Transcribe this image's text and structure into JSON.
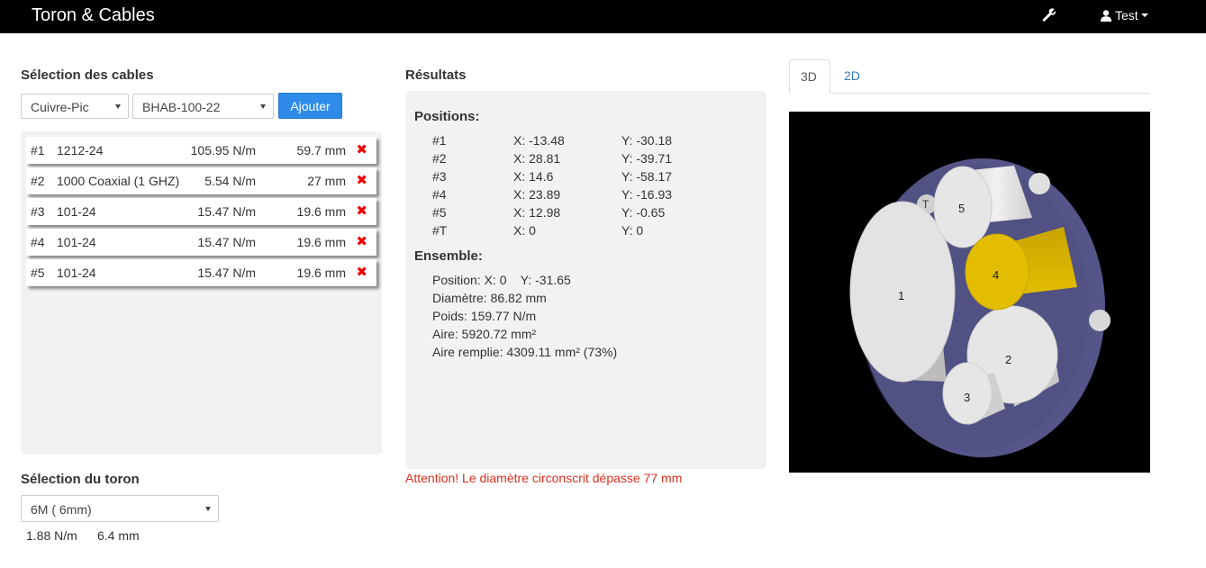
{
  "navbar": {
    "brand": "Toron & Cables",
    "user": "Test"
  },
  "cable_selection": {
    "title": "Sélection des cables",
    "material_select": "Cuivre-Pic",
    "type_select": "BHAB-100-22",
    "add_button": "Ajouter",
    "cables": [
      {
        "num": "#1",
        "name": "1212-24",
        "weight": "105.95 N/m",
        "diameter": "59.7 mm"
      },
      {
        "num": "#2",
        "name": "1000 Coaxial (1 GHZ)",
        "weight": "5.54 N/m",
        "diameter": "27 mm"
      },
      {
        "num": "#3",
        "name": "101-24",
        "weight": "15.47 N/m",
        "diameter": "19.6 mm"
      },
      {
        "num": "#4",
        "name": "101-24",
        "weight": "15.47 N/m",
        "diameter": "19.6 mm"
      },
      {
        "num": "#5",
        "name": "101-24",
        "weight": "15.47 N/m",
        "diameter": "19.6 mm"
      }
    ],
    "delete_glyph": "✖"
  },
  "toron_selection": {
    "title": "Sélection du toron",
    "select": "6M ( 6mm)",
    "weight": "1.88 N/m",
    "diameter": "6.4 mm"
  },
  "results": {
    "title": "Résultats",
    "positions_title": "Positions:",
    "positions": [
      {
        "id": "#1",
        "x": "X: -13.48",
        "y": "Y: -30.18"
      },
      {
        "id": "#2",
        "x": "X: 28.81",
        "y": "Y: -39.71"
      },
      {
        "id": "#3",
        "x": "X: 14.6",
        "y": "Y: -58.17"
      },
      {
        "id": "#4",
        "x": "X: 23.89",
        "y": "Y: -16.93"
      },
      {
        "id": "#5",
        "x": "X: 12.98",
        "y": "Y: -0.65"
      },
      {
        "id": "#T",
        "x": "X: 0",
        "y": "Y: 0"
      }
    ],
    "ensemble_title": "Ensemble:",
    "ensemble": [
      "Position: X: 0    Y: -31.65",
      "Diamètre: 86.82 mm",
      "Poids: 159.77 N/m",
      "Aire: 5920.72 mm²",
      "Aire remplie: 4309.11 mm² (73%)"
    ],
    "warning": "Attention! Le diamètre circonscrit dépasse 77 mm"
  },
  "viewer": {
    "tab_3d": "3D",
    "tab_2d": "2D",
    "labels": {
      "c1": "1",
      "c2": "2",
      "c3": "3",
      "c4": "4",
      "c5": "5",
      "t": "T"
    },
    "colors": {
      "sheath": "#55558a",
      "cable": "#e6e6e6",
      "highlight": "#e3be00",
      "background": "#000000"
    }
  }
}
